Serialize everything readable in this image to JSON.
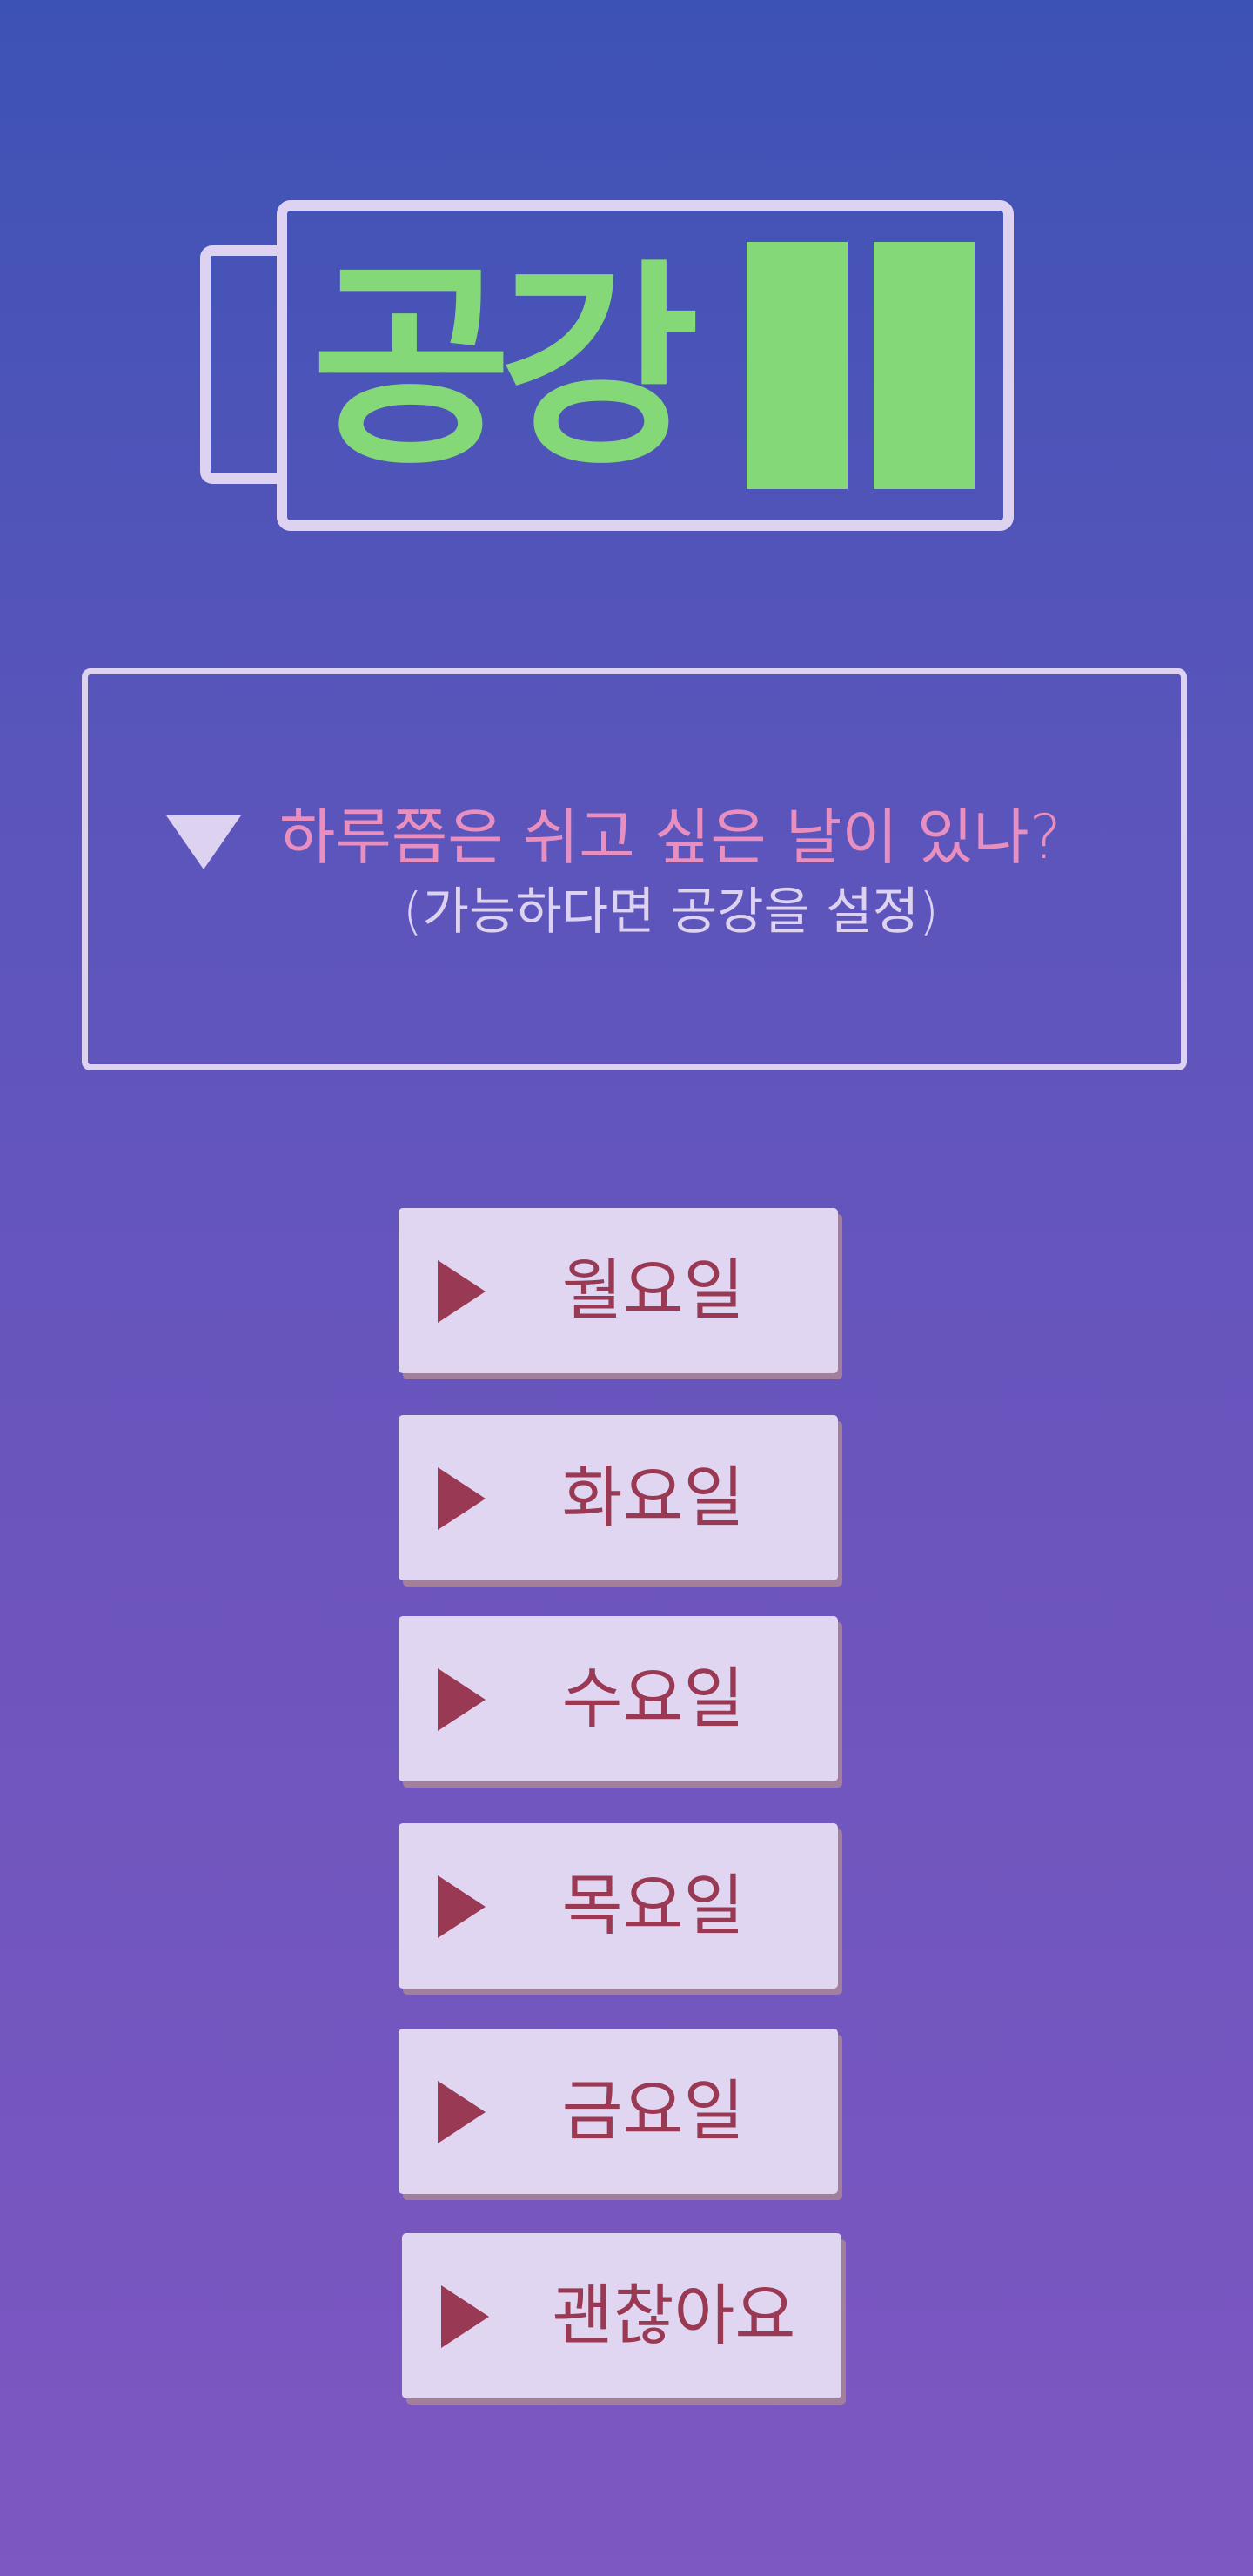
{
  "app": {
    "logo_text": "공강"
  },
  "question": {
    "main": "하루쯤은 쉬고 싶은 날이 있나?",
    "sub": "(가능하다면 공강을 설정)"
  },
  "options": [
    {
      "label": "월요일"
    },
    {
      "label": "화요일"
    },
    {
      "label": "수요일"
    },
    {
      "label": "목요일"
    },
    {
      "label": "금요일"
    },
    {
      "label": "괜찮아요"
    }
  ],
  "colors": {
    "background_top": "#3d52b5",
    "background_bottom": "#7d57c2",
    "logo_green": "#84d877",
    "outline_lavender": "#ddd3f1",
    "question_pink": "#e98fc0",
    "button_face": "#e1d6f1",
    "button_text": "#993953"
  },
  "icons": {
    "prompt": "triangle-down-icon",
    "option": "play-triangle-icon"
  }
}
